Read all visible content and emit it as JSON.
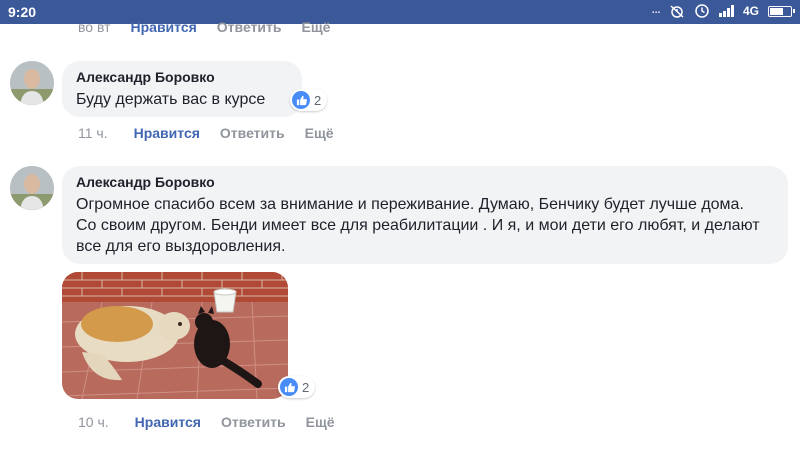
{
  "status_bar": {
    "time": "9:20",
    "network": "4G",
    "icons": [
      "dots-icon",
      "alarm-icon",
      "clock-icon",
      "signal-icon",
      "battery-icon"
    ],
    "battery_level": 0.6
  },
  "top_actions": {
    "time": "во вт",
    "like": "Нравится",
    "reply": "Ответить",
    "more": "Ещё"
  },
  "comments": [
    {
      "author": "Александр Боровко",
      "text": "Буду держать вас в курсе",
      "reaction_count": "2",
      "time": "11 ч.",
      "like": "Нравится",
      "reply": "Ответить",
      "more": "Ещё"
    },
    {
      "author": "Александр Боровко",
      "text": "Огромное спасибо всем за внимание и переживание. Думаю, Бенчику будет лучше дома. Со своим другом. Бенди имеет все для реабилитации . И я, и мои дети его любят, и делают все для его выздоровления.",
      "reaction_count": "2",
      "time": "10 ч.",
      "like": "Нравится",
      "reply": "Ответить",
      "more": "Ещё"
    }
  ],
  "colors": {
    "status_bar": "#3b5998",
    "like_blue": "#4267b2",
    "bubble": "#f2f3f5",
    "muted": "#90949c"
  }
}
